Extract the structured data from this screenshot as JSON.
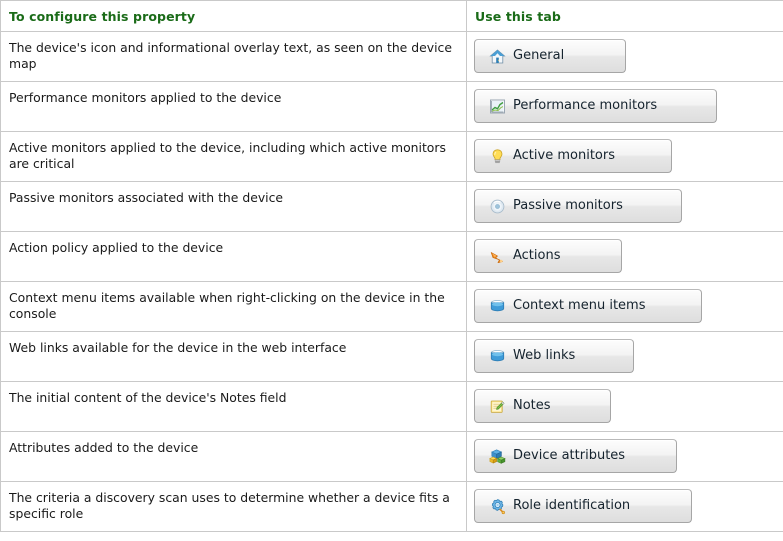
{
  "table": {
    "headers": {
      "property": "To configure this property",
      "tab": "Use this tab"
    },
    "header_color": "#1a6b18",
    "border_color": "#c9c9c9",
    "rows": [
      {
        "property": "The device's icon and informational overlay text, as seen on the device map",
        "tab_label": "General",
        "icon": "house-icon"
      },
      {
        "property": "Performance monitors applied to the device",
        "tab_label": "Performance monitors",
        "icon": "line-chart-icon"
      },
      {
        "property": "Active monitors applied to the device, including which active monitors are critical",
        "tab_label": "Active monitors",
        "icon": "lightbulb-icon"
      },
      {
        "property": "Passive monitors associated with the device",
        "tab_label": "Passive monitors",
        "icon": "disc-icon"
      },
      {
        "property": "Action policy applied to the device",
        "tab_label": "Actions",
        "icon": "lightning-arrow-icon"
      },
      {
        "property": "Context menu items available when right-clicking on the device in the console",
        "tab_label": "Context menu items",
        "icon": "blue-stack-icon"
      },
      {
        "property": "Web links available for the device in the web interface",
        "tab_label": "Web links",
        "icon": "blue-stack-icon"
      },
      {
        "property": "The initial content of the device's Notes field",
        "tab_label": "Notes",
        "icon": "notepad-pencil-icon"
      },
      {
        "property": "Attributes added to the device",
        "tab_label": "Device attributes",
        "icon": "colored-cubes-icon"
      },
      {
        "property": "The criteria a discovery scan uses to determine whether a device fits a specific role",
        "tab_label": "Role identification",
        "icon": "gear-icon"
      }
    ]
  }
}
